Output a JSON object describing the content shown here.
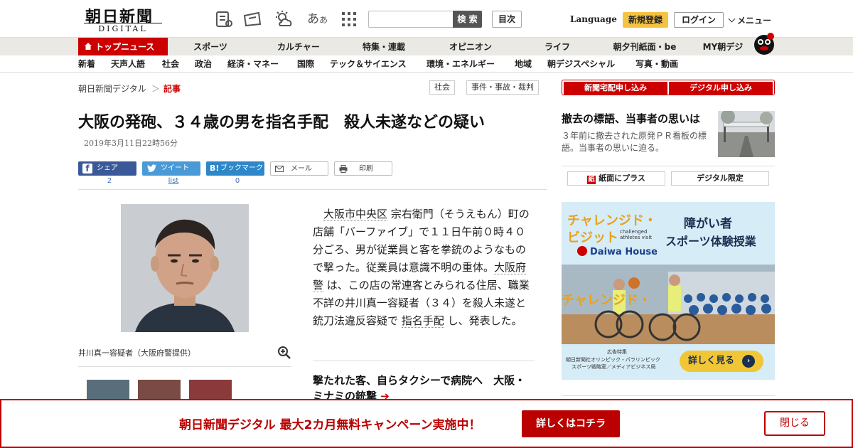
{
  "header": {
    "logo": "朝日新聞",
    "logo_sub": "DIGITAL",
    "search_placeholder": "",
    "search_label": "検 索",
    "toc_label": "目次",
    "language_label": "Language",
    "register_label": "新規登録",
    "login_label": "ログイン",
    "menu_label": "メニュー"
  },
  "nav_primary": {
    "top": "トップニュース",
    "items": [
      "スポーツ",
      "カルチャー",
      "特集・連載",
      "オピニオン",
      "ライフ",
      "朝夕刊紙面・be",
      "MY朝デジ"
    ]
  },
  "nav_secondary": {
    "items": [
      "新着",
      "天声人語",
      "社会",
      "政治",
      "経済・マネー",
      "国際",
      "テック＆サイエンス",
      "環境・エネルギー",
      "地域",
      "朝デジスペシャル",
      "写真・動画"
    ]
  },
  "breadcrumb": {
    "home": "朝日新聞デジタル",
    "sep": "＞",
    "current": "記事"
  },
  "tags": [
    "社会",
    "事件・事故・裁判"
  ],
  "article": {
    "title": "大阪の発砲、３４歳の男を指名手配　殺人未遂などの疑い",
    "date": "2019年3月11日22時56分",
    "photo_caption": "井川真一容疑者（大阪府警提供）",
    "body_p1": "大阪市中央区",
    "body_p2": " 宗右衛門（そうえもん）町の店舗「バーファイブ」で１１日午前０時４０分ごろ、男が従業員と客を拳銃のようなもので撃った。従業員は意識不明の重体。",
    "body_p3": "大阪府警",
    "body_p4": " は、この店の常連客とみられる住居、職業不詳の井川真一容疑者（３４）を殺人未遂と銃刀法違反容疑で ",
    "body_p5": "指名手配",
    "body_p6": " し、発表した。",
    "related": "撃たれた客、自らタクシーで病院へ　大阪・ミナミの銃撃"
  },
  "share": {
    "facebook": "シェア",
    "facebook_count": "2",
    "twitter": "ツイート",
    "twitter_count": "list",
    "hatena": "ブックマーク",
    "hatena_count": "0",
    "mail": "メール",
    "print": "印刷"
  },
  "sidebar": {
    "sub_newspaper": "新聞宅配申し込み",
    "sub_digital": "デジタル申し込み",
    "feature_title": "撤去の標語、当事者の思いは",
    "feature_text": "３年前に撤去された原発ＰＲ看板の標語。当事者の思いに迫る。",
    "paper_plus": "紙面にプラス",
    "digital_only": "デジタル限定",
    "ad": {
      "brand_line1": "チャレンジド・",
      "brand_line2": "ビジット",
      "brand_en": "challenged athletes visit",
      "headline1": "障がい者",
      "headline2": "スポーツ体験授業",
      "sponsor": "Daiwa House",
      "ad_label": "広告特集",
      "ad_credit1": "朝日新聞社オリンピック・パラリンピック",
      "ad_credit2": "スポーツ戦略室／メディアビジネス局",
      "cta": "詳しく見る"
    }
  },
  "banner": {
    "text": "朝日新聞デジタル  最大2カ月無料キャンペーン実施中！",
    "cta": "詳しくはコチラ",
    "close": "閉じる"
  }
}
